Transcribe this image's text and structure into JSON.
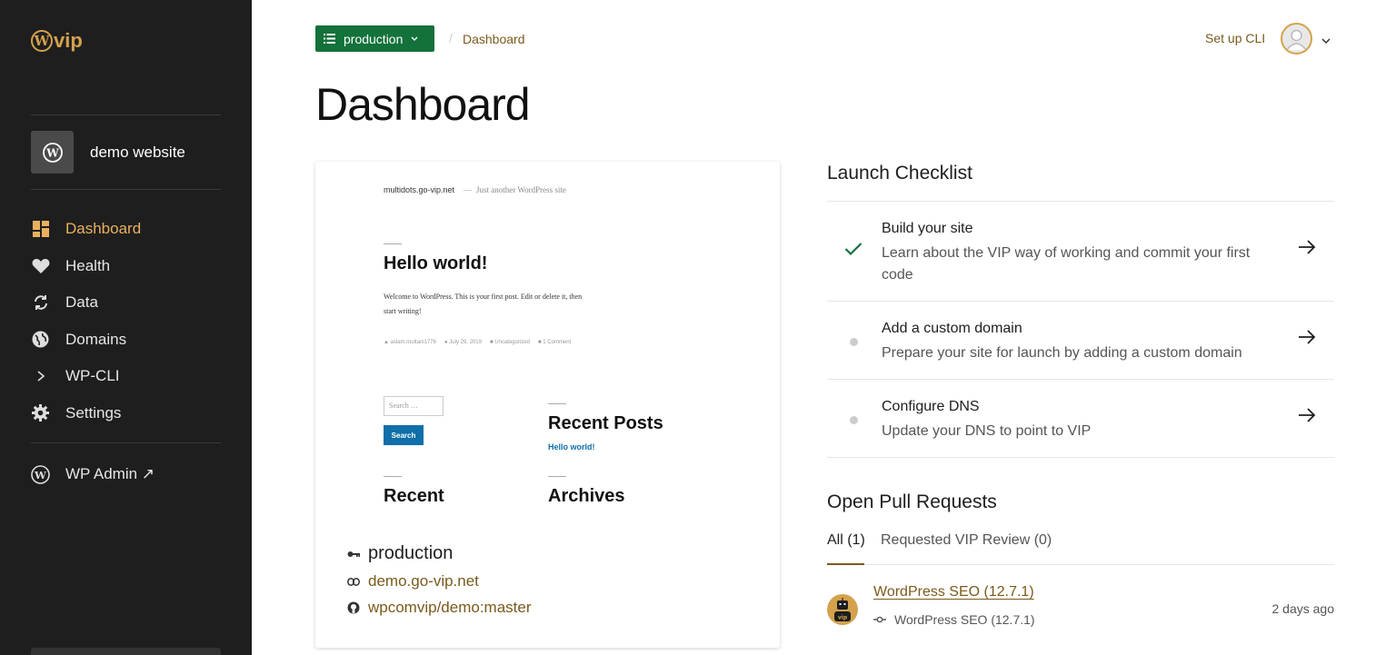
{
  "sidebar": {
    "logo_text": "vip",
    "logo_letter": "W",
    "site_name": "demo website",
    "items": [
      {
        "label": "Dashboard",
        "icon": "dashboard-icon",
        "active": true
      },
      {
        "label": "Health",
        "icon": "heart-icon"
      },
      {
        "label": "Data",
        "icon": "sync-icon"
      },
      {
        "label": "Domains",
        "icon": "globe-icon"
      },
      {
        "label": "WP-CLI",
        "icon": "chevron-right-icon"
      },
      {
        "label": "Settings",
        "icon": "gear-icon"
      }
    ],
    "wp_admin_label": "WP Admin ↗"
  },
  "topbar": {
    "environment": "production",
    "breadcrumb_sep": "/",
    "breadcrumb": "Dashboard",
    "setup_cli": "Set up CLI"
  },
  "page_title": "Dashboard",
  "preview": {
    "site_domain": "multidots.go-vip.net",
    "tagline_sep": "—",
    "tagline": "Just another WordPress site",
    "post_title": "Hello world!",
    "post_body_1": "Welcome to WordPress. This is your first post. Edit or delete it, then",
    "post_body_2": "start writing!",
    "meta_author": "aslam.multani1776",
    "meta_date": "July 29, 2019",
    "meta_category": "Uncategorized",
    "meta_comments": "1 Comment",
    "search_placeholder": "Search …",
    "search_button": "Search",
    "recent_posts_title": "Recent Posts",
    "recent_post_link": "Hello world!",
    "recent_title": "Recent",
    "archives_title": "Archives"
  },
  "environment_info": {
    "name": "production",
    "url": "demo.go-vip.net",
    "repo": "wpcomvip/demo:master"
  },
  "launch_checklist": {
    "title": "Launch Checklist",
    "items": [
      {
        "title": "Build your site",
        "desc": "Learn about the VIP way of working and commit your first code",
        "status": "done"
      },
      {
        "title": "Add a custom domain",
        "desc": "Prepare your site for launch by adding a custom domain",
        "status": "pending"
      },
      {
        "title": "Configure DNS",
        "desc": "Update your DNS to point to VIP",
        "status": "pending"
      }
    ]
  },
  "pull_requests": {
    "title": "Open Pull Requests",
    "tabs": [
      {
        "label": "All (1)",
        "active": true
      },
      {
        "label": "Requested VIP Review (0)"
      }
    ],
    "items": [
      {
        "title": "WordPress SEO (12.7.1)",
        "branch": "WordPress SEO (12.7.1)",
        "time": "2 days ago"
      }
    ]
  },
  "colors": {
    "sidebar_bg": "#1e1e1e",
    "accent_gold": "#d4a24c",
    "link_brown": "#7a5a1c",
    "env_green": "#13713a",
    "check_green": "#13713a"
  }
}
